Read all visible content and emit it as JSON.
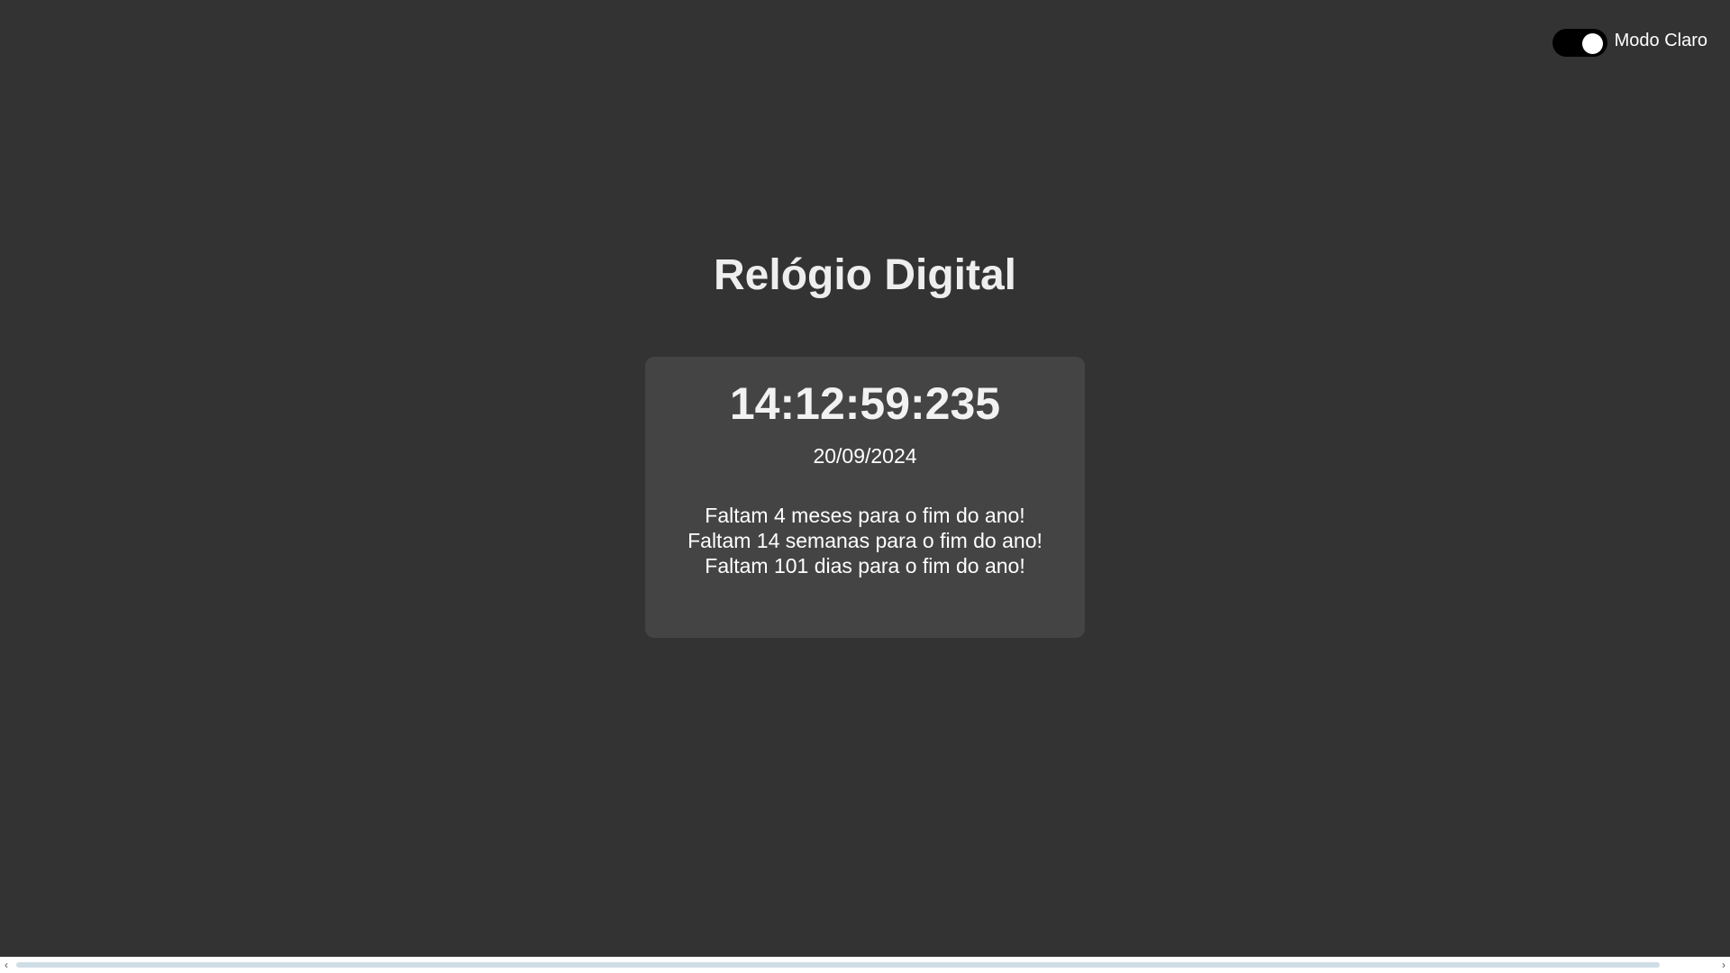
{
  "theme_toggle": {
    "label": "Modo Claro",
    "state": "on"
  },
  "title": "Relógio Digital",
  "clock": {
    "time": "14:12:59:235",
    "date": "20/09/2024"
  },
  "countdown": [
    "Faltam 4 meses para o fim do ano!",
    "Faltam 14 semanas para o fim do ano!",
    "Faltam 101 dias para o fim do ano!"
  ],
  "colors": {
    "background": "#333333",
    "card": "#444444",
    "text": "#ffffff",
    "toggle_track": "#000000",
    "scroll_thumb": "#cfdde6"
  },
  "scrollbar": {
    "left_arrow": "‹",
    "right_arrow": "›"
  }
}
